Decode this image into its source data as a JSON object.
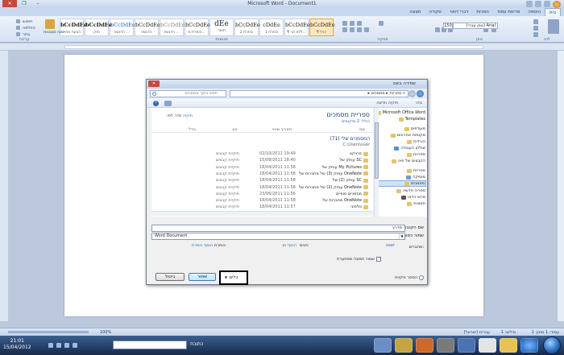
{
  "window": {
    "title": "Microsoft Word - Document1"
  },
  "tabs": [
    {
      "label": "בית",
      "active": true
    },
    {
      "label": "הוספה",
      "active": false
    },
    {
      "label": "פריסת עמוד",
      "active": false
    },
    {
      "label": "הפניות",
      "active": false
    },
    {
      "label": "דברי דואר",
      "active": false
    },
    {
      "label": "סקירה",
      "active": false
    },
    {
      "label": "תצוגה",
      "active": false
    }
  ],
  "ribbon": {
    "font_name": "Arial (גופן עברי)",
    "font_size": "150",
    "styles": [
      {
        "preview": "bCcDdEe",
        "name": "¶ רגיל",
        "selected": true
      },
      {
        "preview": "bCcDdEe",
        "name": "¶ ללא מר...",
        "selected": false
      },
      {
        "preview": "cDdEe",
        "name": "כותרת 1",
        "selected": false
      },
      {
        "preview": "bCcDdEe",
        "name": "כותרת 2",
        "selected": false
      },
      {
        "preview": "dEe",
        "name": "תואר",
        "selected": false
      },
      {
        "preview": "bCcDdEe",
        "name": "כותרת מ...",
        "selected": false
      },
      {
        "preview": "bCcDdEe",
        "name": "הדגשת ...",
        "selected": false
      },
      {
        "preview": "bCcDdEe",
        "name": "הדגשה",
        "selected": false
      },
      {
        "preview": "bCcDdEe",
        "name": "הדגשה ...",
        "selected": false
      },
      {
        "preview": "bCcDdEe",
        "name": "חזק",
        "selected": false
      },
      {
        "preview": "bCcDdEe",
        "name": "הצעת מחיר",
        "selected": false
      }
    ],
    "change_styles_label": "שנה סגנונות",
    "find_label": "חיפוש",
    "replace_label": "החלפה",
    "select_label": "בחר",
    "group_clipboard": "לוח",
    "group_font": "גופן",
    "group_paragraph": "פסקה",
    "group_styles": "סגנונות",
    "group_editing": "עריכה"
  },
  "dialog": {
    "title": "שמירה בשם",
    "path": "« ספריות ▸ מסמכים ▸",
    "search_placeholder": "חפש בתוך מסמכים",
    "toolbar_organize": "סדר",
    "toolbar_new_folder": "תיקיה חדשה",
    "library_title": "ספריית מסמכים",
    "library_subtitle": "כולל: 2 מיקומים",
    "arrange_by_label": "סדר לפי:",
    "arrange_by_value": "תיקיה",
    "columns": {
      "name": "שם",
      "date": "תאריך שינוי",
      "type": "סוג",
      "size": "גודל"
    },
    "group_header": "המסמכים שלי (71)",
    "group_path": "C:\\Users\\user",
    "rows": [
      {
        "name": "פרויקט",
        "date": "02/10/2011 19:49",
        "type": "תיקיית קבצים"
      },
      {
        "name": "SC עותק של",
        "date": "15/08/2011 18:40",
        "type": "תיקיית קבצים"
      },
      {
        "name": "My Pictures עותק של",
        "date": "18/04/2011 11:58",
        "type": "תיקיית קבצים"
      },
      {
        "name": "OneNote עותק (3) של מחברות של",
        "date": "18/04/2011 11:58",
        "type": "תיקיית קבצים"
      },
      {
        "name": "SC עותק (2) של",
        "date": "18/04/2011 11:58",
        "type": "תיקיית קבצים"
      },
      {
        "name": "OneNote עותק (2) של מחברות של",
        "date": "18/04/2011 11:58",
        "type": "תיקיית קבצים"
      },
      {
        "name": "מסמכים סופיים",
        "date": "23/06/2011 11:56",
        "type": "תיקיית קבצים"
      },
      {
        "name": "OneNote מחברות של",
        "date": "18/04/2011 11:58",
        "type": "תיקיית קבצים"
      },
      {
        "name": "טלפוני",
        "date": "18/04/2011 11:57",
        "type": "תיקיית קבצים"
      }
    ],
    "nav": [
      {
        "label": "Microsoft Office Word",
        "selected": false
      },
      {
        "label": "Templates",
        "selected": false
      },
      {
        "label": "מועדפים",
        "selected": false
      },
      {
        "label": "מקומות אחרונים",
        "selected": false
      },
      {
        "label": "הורדות",
        "selected": false
      },
      {
        "label": "שולחן העבודה",
        "selected": false
      },
      {
        "label": "ספריות",
        "selected": false
      },
      {
        "label": "הקבצים של פיני",
        "selected": false
      },
      {
        "label": "ספריות",
        "selected": false
      },
      {
        "label": "מוסיקה",
        "selected": false
      },
      {
        "label": "מסמכים",
        "selected": true
      },
      {
        "label": "ספריה חדשה",
        "selected": false
      },
      {
        "label": "סרטי וידאו",
        "selected": false
      },
      {
        "label": "תמונות",
        "selected": false
      }
    ],
    "filename_label": "שם הקובץ:",
    "filename_value": "מדריך",
    "savetype_label": "שמור כסוג:",
    "savetype_value": "Word Document",
    "authors_label": "מחברים:",
    "authors_value": "user",
    "tags_label": "תגים:",
    "tags_value": "הוסף תג",
    "title_label": "כותרת:",
    "title_value": "הוסף כותרת",
    "thumbnail_label": "שמור תמונה ממוזערת",
    "hide_folders_label": "הסתר תיקיות",
    "tools_label": "כלים",
    "save_label": "שמור",
    "cancel_label": "ביטול"
  },
  "statusbar": {
    "page": "עמוד: 1 מתוך 1",
    "words": "מילים: 1",
    "language": "עברית (ישראל)",
    "zoom": "100%"
  },
  "taskbar": {
    "time": "21:01",
    "date": "15/04/2012",
    "address_label": "כתובת"
  }
}
